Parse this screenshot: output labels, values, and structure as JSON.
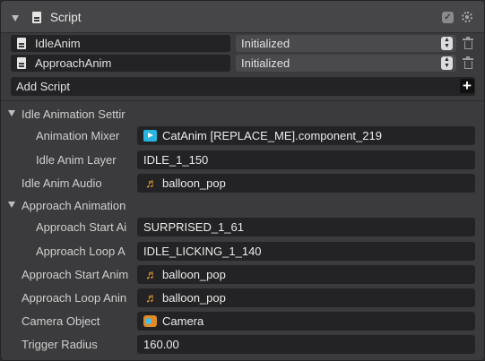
{
  "header": {
    "title": "Script",
    "icons": [
      "collapse-triangle",
      "script-document-icon",
      "enabled-check-icon",
      "settings-gear-icon"
    ]
  },
  "scripts": [
    {
      "name": "IdleAnim",
      "state": "Initialized"
    },
    {
      "name": "ApproachAnim",
      "state": "Initialized"
    }
  ],
  "add_script_label": "Add Script",
  "groups": {
    "idle": "Idle Animation Settir",
    "approach": "Approach Animation"
  },
  "props": {
    "animation_mixer": {
      "label": "Animation Mixer",
      "value": "CatAnim [REPLACE_ME].component_219",
      "icon": "animation-mixer-icon"
    },
    "idle_anim_layer": {
      "label": "Idle Anim Layer",
      "value": "IDLE_1_150"
    },
    "idle_anim_audio": {
      "label": "Idle Anim Audio",
      "value": "balloon_pop",
      "icon": "audio-note-icon"
    },
    "approach_start_anim": {
      "label": "Approach Start Ai",
      "value": "SURPRISED_1_61"
    },
    "approach_loop_anim": {
      "label": "Approach Loop A",
      "value": "IDLE_LICKING_1_140"
    },
    "approach_start_audio": {
      "label": "Approach Start Anim",
      "value": "balloon_pop",
      "icon": "audio-note-icon"
    },
    "approach_loop_audio": {
      "label": "Approach Loop Anin",
      "value": "balloon_pop",
      "icon": "audio-note-icon"
    },
    "camera_object": {
      "label": "Camera Object",
      "value": "Camera",
      "icon": "camera-icon"
    },
    "trigger_radius": {
      "label": "Trigger Radius",
      "value": "160.00"
    }
  },
  "colors": {
    "panel_bg": "#3b3b3d",
    "header_bg": "#464648",
    "field_bg": "#232325",
    "state_bg": "#4a4a4d",
    "mixer_icon": "#27b5e0",
    "audio_icon": "#f0a030"
  }
}
